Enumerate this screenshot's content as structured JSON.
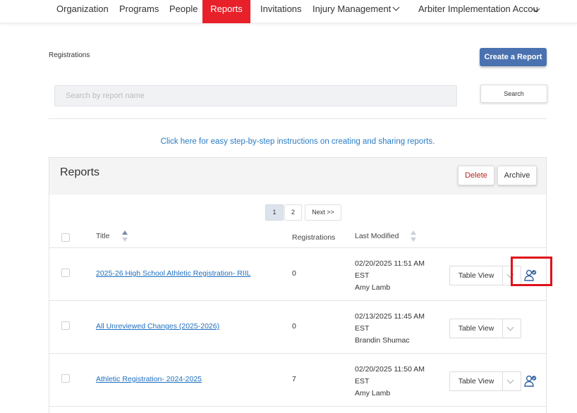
{
  "nav": {
    "items": [
      {
        "label": "Organization"
      },
      {
        "label": "Programs"
      },
      {
        "label": "People"
      },
      {
        "label": "Reports"
      },
      {
        "label": "Invitations"
      },
      {
        "label": "Injury Management"
      },
      {
        "label": "Arbiter Implementation Accou"
      }
    ]
  },
  "page": {
    "breadcrumb": "Registrations",
    "create_button": "Create a Report",
    "search_placeholder": "Search by report name",
    "search_button": "Search",
    "help_link": "Click here for easy step-by-step instructions on creating and sharing reports."
  },
  "panel": {
    "title": "Reports",
    "delete_button": "Delete",
    "archive_button": "Archive",
    "pagination": {
      "pages": [
        "1",
        "2"
      ],
      "next": "Next >>"
    },
    "columns": {
      "title": "Title",
      "registrations": "Registrations",
      "last_modified": "Last Modified"
    },
    "rows": [
      {
        "title": "2025-26 High School Athletic Registration- RIIL",
        "registrations": "0",
        "date": "02/20/2025 11:51 AM",
        "tz": "EST",
        "user": "Amy Lamb",
        "view": "Table View"
      },
      {
        "title": "All Unreviewed Changes (2025-2026)",
        "registrations": "0",
        "date": "02/13/2025 11:45 AM",
        "tz": "EST",
        "user": "Brandin Shumac",
        "view": "Table View"
      },
      {
        "title": "Athletic Registration- 2024-2025",
        "registrations": "7",
        "date": "02/20/2025 11:50 AM",
        "tz": "EST",
        "user": "Amy Lamb",
        "view": "Table View"
      }
    ]
  },
  "colors": {
    "active_nav": "#e8202a",
    "primary_button": "#4a72b0",
    "link": "#1f6fbf",
    "highlight": "#e0101a"
  }
}
